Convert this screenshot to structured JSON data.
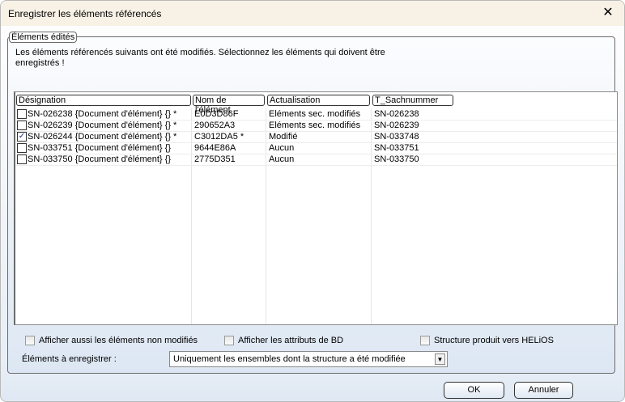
{
  "window": {
    "title": "Enregistrer les éléments référencés",
    "close_icon": "close-icon"
  },
  "group": {
    "label": "Éléments édités",
    "intro": "Les éléments référencés suivants ont été modifiés. Sélectionnez les éléments qui doivent être enregistrés !"
  },
  "table": {
    "columns": [
      "Désignation",
      "Nom de l'élément",
      "Actualisation",
      "T_Sachnummer"
    ],
    "rows": [
      {
        "checked": false,
        "designation": "SN-026238 {Document d'élément} {} *",
        "name": "E0D3D86F",
        "update": "Eléments sec. modifiés",
        "sachnummer": "SN-026238"
      },
      {
        "checked": false,
        "designation": "SN-026239 {Document d'élément} {} *",
        "name": "290652A3",
        "update": "Eléments sec. modifiés",
        "sachnummer": "SN-026239"
      },
      {
        "checked": true,
        "designation": "SN-026244 {Document d'élément} {} *",
        "name": "C3012DA5 *",
        "update": "Modifié",
        "sachnummer": "SN-033748"
      },
      {
        "checked": false,
        "designation": "SN-033751 {Document d'élément} {}",
        "name": "9644E86A",
        "update": "Aucun",
        "sachnummer": "SN-033751"
      },
      {
        "checked": false,
        "designation": "SN-033750 {Document d'élément} {}",
        "name": "2775D351",
        "update": "Aucun",
        "sachnummer": "SN-033750"
      }
    ]
  },
  "options": {
    "show_unmodified": "Afficher aussi les éléments non modifiés",
    "show_db_attrs": "Afficher les attributs de BD",
    "structure_helios": "Structure produit vers HELiOS"
  },
  "save": {
    "label": "Éléments à enregistrer :",
    "value": "Uniquement les ensembles dont la structure a été modifiée"
  },
  "buttons": {
    "ok": "OK",
    "cancel": "Annuler"
  }
}
